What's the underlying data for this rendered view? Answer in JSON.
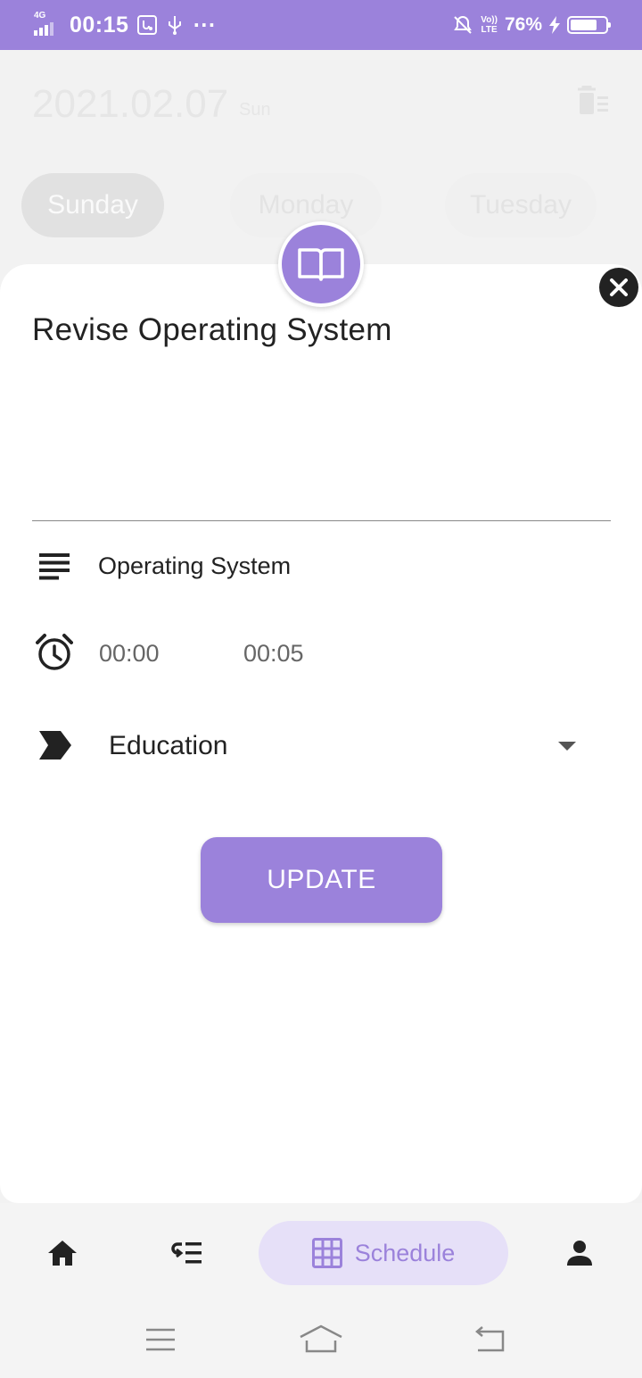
{
  "status_bar": {
    "network": "4G",
    "time": "00:15",
    "volte_top": "Vo))",
    "volte_bottom": "LTE",
    "battery_percent": "76%",
    "battery_level": 0.76
  },
  "background": {
    "date": "2021.02.07",
    "day_short": "Sun",
    "days": [
      "Sunday",
      "Monday",
      "Tuesday"
    ]
  },
  "task": {
    "title": "Revise Operating System",
    "subject": "Operating System",
    "start_time": "00:00",
    "end_time": "00:05",
    "category": "Education",
    "update_label": "UPDATE"
  },
  "bottom_nav": {
    "items": [
      "home-icon",
      "task-list-icon",
      "schedule-grid-icon",
      "person-icon"
    ],
    "active_label": "Schedule"
  },
  "colors": {
    "accent": "#9b82db",
    "accent_light": "#e6e0f8",
    "dark": "#222222"
  }
}
